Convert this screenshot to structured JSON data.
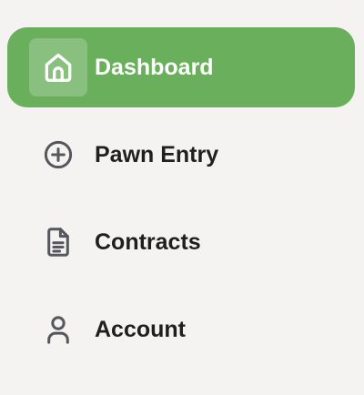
{
  "nav": {
    "items": [
      {
        "label": "Dashboard",
        "icon": "home-icon",
        "active": true
      },
      {
        "label": "Pawn Entry",
        "icon": "plus-circle-icon",
        "active": false
      },
      {
        "label": "Contracts",
        "icon": "document-icon",
        "active": false
      },
      {
        "label": "Account",
        "icon": "user-icon",
        "active": false
      }
    ]
  },
  "colors": {
    "background": "#f4f3f1",
    "active_bg": "#6aaf5c",
    "active_text": "#ffffff",
    "text": "#1f1f1f",
    "icon": "#55575c"
  }
}
